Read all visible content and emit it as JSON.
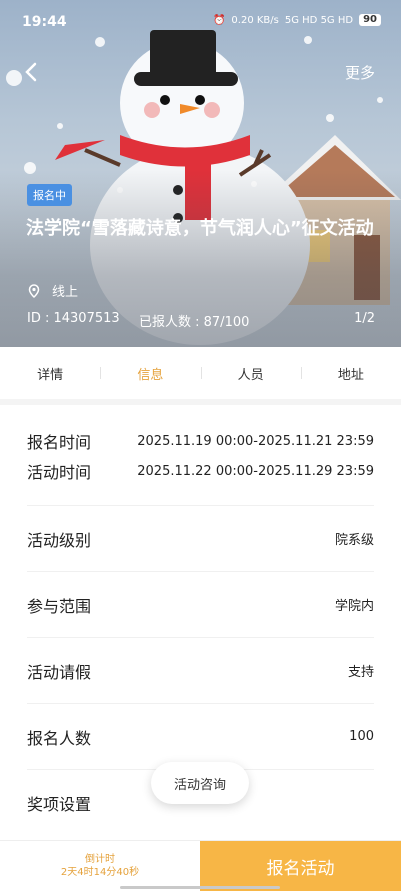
{
  "status_bar": {
    "time": "19:44",
    "network_speed": "0.20 KB/s",
    "signal": "5G HD 5G HD",
    "battery": "90"
  },
  "header": {
    "more_label": "更多"
  },
  "hero": {
    "status_tag": "报名中",
    "title": "法学院“雪落藏诗意，节气润人心”征文活动",
    "location": "线上",
    "activity_id": "ID : 14307513",
    "signup_count": "已报人数 : 87/100",
    "page_indicator": "1/2"
  },
  "tabs": [
    {
      "label": "详情"
    },
    {
      "label": "信息"
    },
    {
      "label": "人员"
    },
    {
      "label": "地址"
    }
  ],
  "info": {
    "signup_time": {
      "label": "报名时间",
      "value": "2025.11.19 00:00-2025.11.21 23:59"
    },
    "activity_time": {
      "label": "活动时间",
      "value": "2025.11.22 00:00-2025.11.29 23:59"
    },
    "rows": [
      {
        "label": "活动级别",
        "value": "院系级"
      },
      {
        "label": "参与范围",
        "value": "学院内"
      },
      {
        "label": "活动请假",
        "value": "支持"
      },
      {
        "label": "报名人数",
        "value": "100"
      },
      {
        "label": "奖项设置",
        "value": ""
      }
    ]
  },
  "consult_button": "活动咨询",
  "bottom": {
    "countdown_label": "倒计时",
    "countdown_value": "2天4时14分40秒",
    "signup_button": "报名活动"
  },
  "colors": {
    "accent": "#e5a23c",
    "signup_button": "#f7b646",
    "status_tag": "#4a90e2"
  }
}
